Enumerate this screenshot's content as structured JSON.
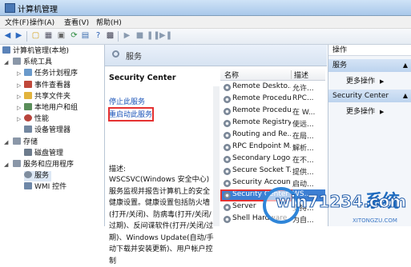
{
  "window": {
    "title": "计算机管理"
  },
  "menu": [
    "文件(F)",
    "操作(A)",
    "查看(V)",
    "帮助(H)"
  ],
  "tree": {
    "root": "计算机管理(本地)",
    "system_tools": "系统工具",
    "task_scheduler": "任务计划程序",
    "event_viewer": "事件查看器",
    "shared_folders": "共享文件夹",
    "local_users": "本地用户和组",
    "performance": "性能",
    "device_manager": "设备管理器",
    "storage": "存储",
    "disk_management": "磁盘管理",
    "services_apps": "服务和应用程序",
    "services": "服务",
    "wmi": "WMI 控件"
  },
  "middle": {
    "header": "服务",
    "service_title": "Security Center",
    "stop_link": "停止此服务",
    "restart_link": "重启动此服务",
    "desc_label": "描述:",
    "description": "WSCSVC(Windows 安全中心)服务监视并报告计算机上的安全健康设置。健康设置包括防火墙(打开/关闭)、防病毒(打开/关闭/过期)、反间谍软件(打开/关闭/过期)、Windows Update(自动/手动下载并安装更新)、用户帐户控制"
  },
  "list": {
    "col_name": "名称",
    "col_desc": "描述",
    "rows": [
      {
        "name": "Remote Deskto...",
        "desc": "允许..."
      },
      {
        "name": "Remote Procedu...",
        "desc": "RPC..."
      },
      {
        "name": "Remote Procedu...",
        "desc": "在 W..."
      },
      {
        "name": "Remote Registry",
        "desc": "使远..."
      },
      {
        "name": "Routing and Re...",
        "desc": "在局..."
      },
      {
        "name": "RPC Endpoint M...",
        "desc": "解析..."
      },
      {
        "name": "Secondary Logon",
        "desc": "在不..."
      },
      {
        "name": "Secure Socket T...",
        "desc": "提供..."
      },
      {
        "name": "Security Account...",
        "desc": "启动..."
      },
      {
        "name": "Security Center",
        "desc": "WS..."
      },
      {
        "name": "Server",
        "desc": "支持..."
      },
      {
        "name": "Shell Hardware ...",
        "desc": "为自..."
      }
    ]
  },
  "actions": {
    "header": "操作",
    "section1": "服务",
    "more1": "更多操作",
    "section2": "Security Center",
    "more2": "更多操作"
  },
  "watermark": {
    "brand": "系统",
    "url": "win71234.com",
    "sub": "XITONGZU.COM"
  },
  "colors": {
    "selection": "#3d7fd3",
    "highlight_box": "#e53131",
    "link": "#1c55b9"
  }
}
